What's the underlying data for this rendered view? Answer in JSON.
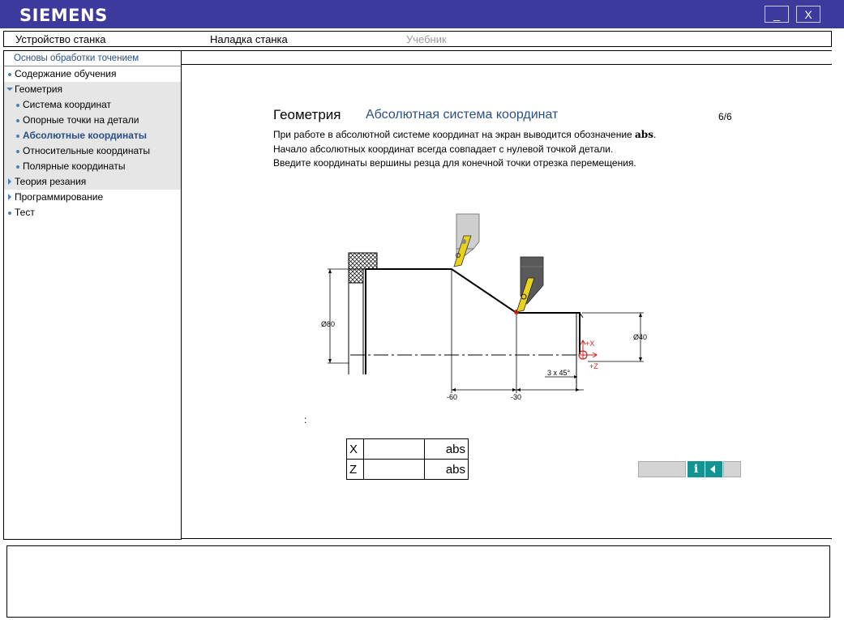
{
  "app": {
    "logo": "SIEMENS",
    "minimize_label": "_",
    "close_label": "X"
  },
  "menu": {
    "items": [
      "Устройство станка",
      "Наладка станка",
      "Учебник"
    ]
  },
  "sidebar": {
    "header": "Основы обработки точением",
    "items": [
      {
        "label": "Содержание обучения"
      },
      {
        "label": "Геометрия"
      },
      {
        "label": "Система координат"
      },
      {
        "label": "Опорные точки на детали"
      },
      {
        "label": "Абсолютные координаты"
      },
      {
        "label": "Относительные координаты"
      },
      {
        "label": "Полярные координаты"
      },
      {
        "label": "Теория резания"
      },
      {
        "label": "Программирование"
      },
      {
        "label": "Тест"
      }
    ]
  },
  "lesson": {
    "title": "Геометрия",
    "subtitle": "Абсолютная система координат",
    "page": "6/6",
    "line1_prefix": "При работе в абсолютной системе координат на экран выводится обозначение ",
    "line1_bold": "abs",
    "line1_suffix": ".",
    "line2": "Начало абсолютных координат всегда совпадает с нулевой точкой детали.",
    "line3": "Введите координаты вершины резца для конечной точки отрезка перемещения."
  },
  "drawing": {
    "dim_d80": "Ø80",
    "dim_d40": "Ø40",
    "chamfer": "3 x 45°",
    "axis_x": "+X",
    "axis_z": "+Z",
    "tick_m60": "-60",
    "tick_m30": "-30"
  },
  "input": {
    "colon": ":",
    "rows": [
      {
        "axis": "X",
        "value": "",
        "unit": "abs"
      },
      {
        "axis": "Z",
        "value": "",
        "unit": "abs"
      }
    ]
  },
  "nav": {
    "info_label": "i"
  },
  "colors": {
    "titlebar": "#3d3a9e",
    "accent_text": "#2a4f86",
    "nav_button": "#159393",
    "marker": "#d02020"
  }
}
